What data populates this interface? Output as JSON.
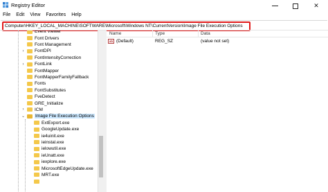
{
  "window": {
    "title": "Registry Editor",
    "controls": {
      "minimize": "—",
      "maximize": "☐",
      "close": "✕"
    },
    "icon": "registry-editor-icon"
  },
  "menu": [
    "File",
    "Edit",
    "View",
    "Favorites",
    "Help"
  ],
  "address": {
    "path": "Computer\\HKEY_LOCAL_MACHINE\\SOFTWARE\\Microsoft\\Windows NT\\CurrentVersion\\Image File Execution Options",
    "highlight_color": "#e01818"
  },
  "tree": {
    "items": [
      {
        "label": "Event Viewer",
        "expander": ""
      },
      {
        "label": "Font Drivers",
        "expander": ""
      },
      {
        "label": "Font Management",
        "expander": ""
      },
      {
        "label": "FontDPI",
        "expander": "›"
      },
      {
        "label": "FontIntensityCorrection",
        "expander": ""
      },
      {
        "label": "FontLink",
        "expander": "›"
      },
      {
        "label": "FontMapper",
        "expander": ""
      },
      {
        "label": "FontMapperFamilyFallback",
        "expander": ""
      },
      {
        "label": "Fonts",
        "expander": ""
      },
      {
        "label": "FontSubstitutes",
        "expander": ""
      },
      {
        "label": "FveDetect",
        "expander": ""
      },
      {
        "label": "GRE_Initialize",
        "expander": ""
      },
      {
        "label": "ICM",
        "expander": "›"
      },
      {
        "label": "Image File Execution Options",
        "expander": "⌄",
        "selected": true
      },
      {
        "label": "ExtExport.exe",
        "expander": "",
        "child": true
      },
      {
        "label": "GoogleUpdate.exe",
        "expander": "",
        "child": true
      },
      {
        "label": "ie4uinit.exe",
        "expander": "",
        "child": true
      },
      {
        "label": "ieinstal.exe",
        "expander": "",
        "child": true
      },
      {
        "label": "ielowutil.exe",
        "expander": "",
        "child": true
      },
      {
        "label": "ieUnatt.exe",
        "expander": "",
        "child": true
      },
      {
        "label": "iexplore.exe",
        "expander": "",
        "child": true
      },
      {
        "label": "MicrosoftEdgeUpdate.exe",
        "expander": "",
        "child": true
      },
      {
        "label": "MRT.exe",
        "expander": "",
        "child": true
      },
      {
        "label": "",
        "expander": "",
        "child": true
      }
    ],
    "folder_color": "#f4c84a",
    "selected_bg": "#cce8ff"
  },
  "list": {
    "columns": [
      "Name",
      "Type",
      "Data"
    ],
    "rows": [
      {
        "icon": "ab",
        "name": "(Default)",
        "type": "REG_SZ",
        "data": "(value not set)"
      }
    ]
  }
}
